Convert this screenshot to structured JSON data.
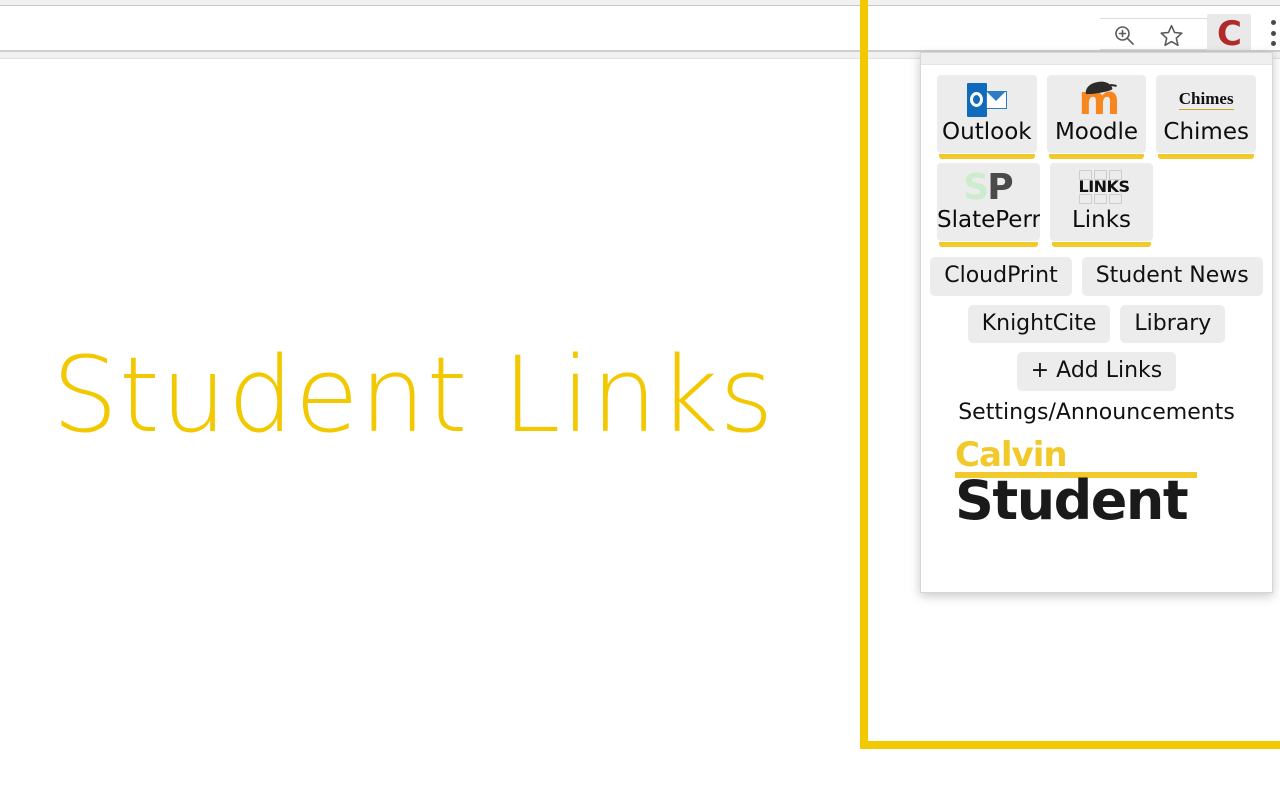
{
  "browser": {
    "toolbar": {
      "zoom_icon": "zoom-in-icon",
      "bookmark_icon": "star-icon",
      "extension_icon_letter": "C",
      "menu_icon": "three-dot-menu-icon"
    }
  },
  "page": {
    "title": "Student Links",
    "accent_color": "#F2C800"
  },
  "popup": {
    "tiles": [
      {
        "label": "Outlook",
        "icon": "outlook-icon"
      },
      {
        "label": "Moodle",
        "icon": "moodle-icon"
      },
      {
        "label": "Chimes",
        "icon": "chimes-icon",
        "icon_text": "Chimes"
      },
      {
        "label": "SlatePermission",
        "icon": "slatepermission-icon",
        "icon_text_a": "S",
        "icon_text_b": "P"
      },
      {
        "label": "Links",
        "icon": "links-grid-icon",
        "icon_text": "LINKS"
      }
    ],
    "pills": [
      {
        "label": "CloudPrint"
      },
      {
        "label": "Student News"
      },
      {
        "label": "KnightCite"
      },
      {
        "label": "Library"
      }
    ],
    "add_links_label": "+ Add Links",
    "settings_label": "Settings/Announcements",
    "logo": {
      "top": "Calvin",
      "bottom": "Student",
      "top_color": "#F2C92B",
      "bottom_color": "#1a1a1a"
    }
  }
}
